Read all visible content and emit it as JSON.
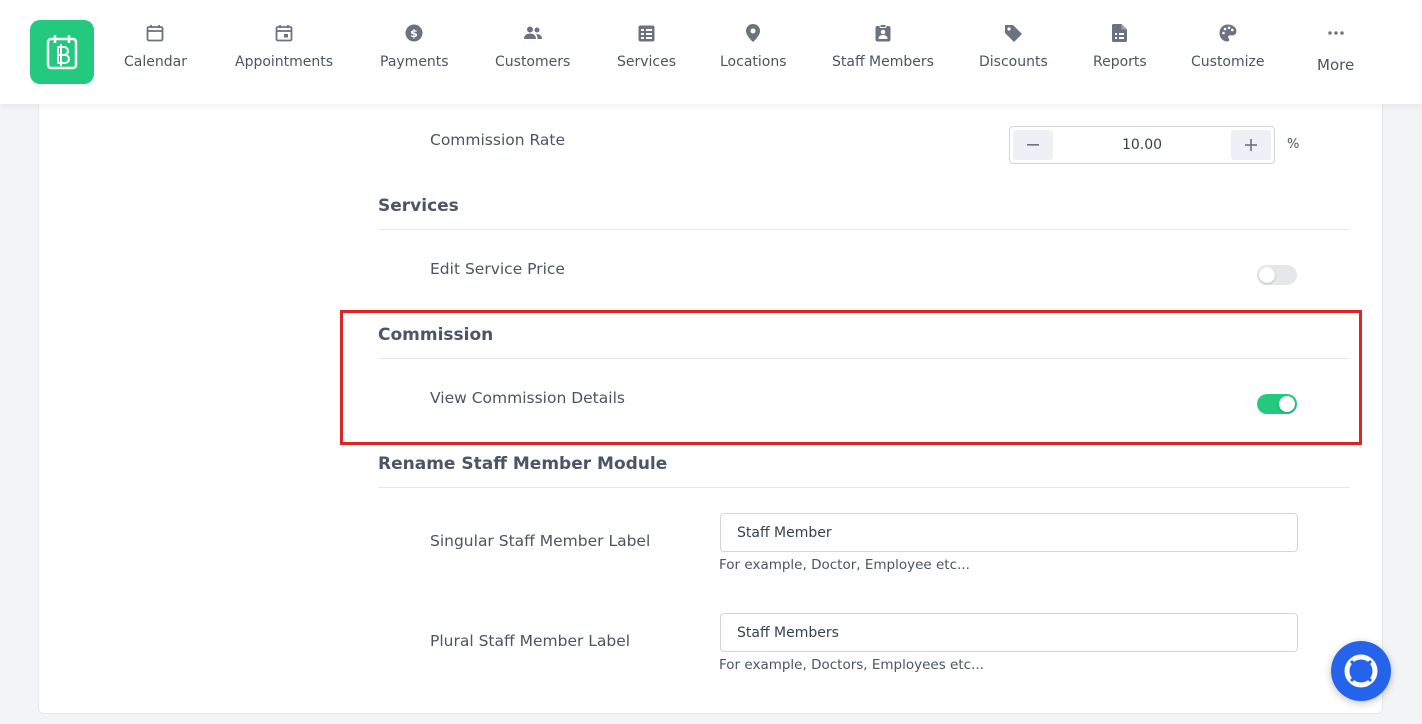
{
  "nav": {
    "items": [
      {
        "label": "Calendar",
        "icon": "calendar-icon"
      },
      {
        "label": "Appointments",
        "icon": "calendar-check-icon"
      },
      {
        "label": "Payments",
        "icon": "dollar-circle-icon"
      },
      {
        "label": "Customers",
        "icon": "users-icon"
      },
      {
        "label": "Services",
        "icon": "list-icon"
      },
      {
        "label": "Locations",
        "icon": "map-pin-icon"
      },
      {
        "label": "Staff Members",
        "icon": "badge-icon"
      },
      {
        "label": "Discounts",
        "icon": "tag-icon"
      },
      {
        "label": "Reports",
        "icon": "report-icon"
      },
      {
        "label": "Customize",
        "icon": "palette-icon"
      }
    ],
    "more_label": "More"
  },
  "commission_rate": {
    "label": "Commission Rate",
    "value": "10.00",
    "unit": "%"
  },
  "services_section": {
    "title": "Services",
    "edit_price_label": "Edit Service Price",
    "edit_price_enabled": false
  },
  "commission_section": {
    "title": "Commission",
    "view_details_label": "View Commission Details",
    "view_details_enabled": true
  },
  "rename_section": {
    "title": "Rename Staff Member Module",
    "singular_label": "Singular Staff Member Label",
    "singular_value": "Staff Member",
    "singular_hint": "For example, Doctor, Employee etc...",
    "plural_label": "Plural Staff Member Label",
    "plural_value": "Staff Members",
    "plural_hint": "For example, Doctors, Employees etc..."
  },
  "colors": {
    "accent": "#22c97f",
    "highlight": "#dc2626",
    "help_button": "#2563eb"
  }
}
